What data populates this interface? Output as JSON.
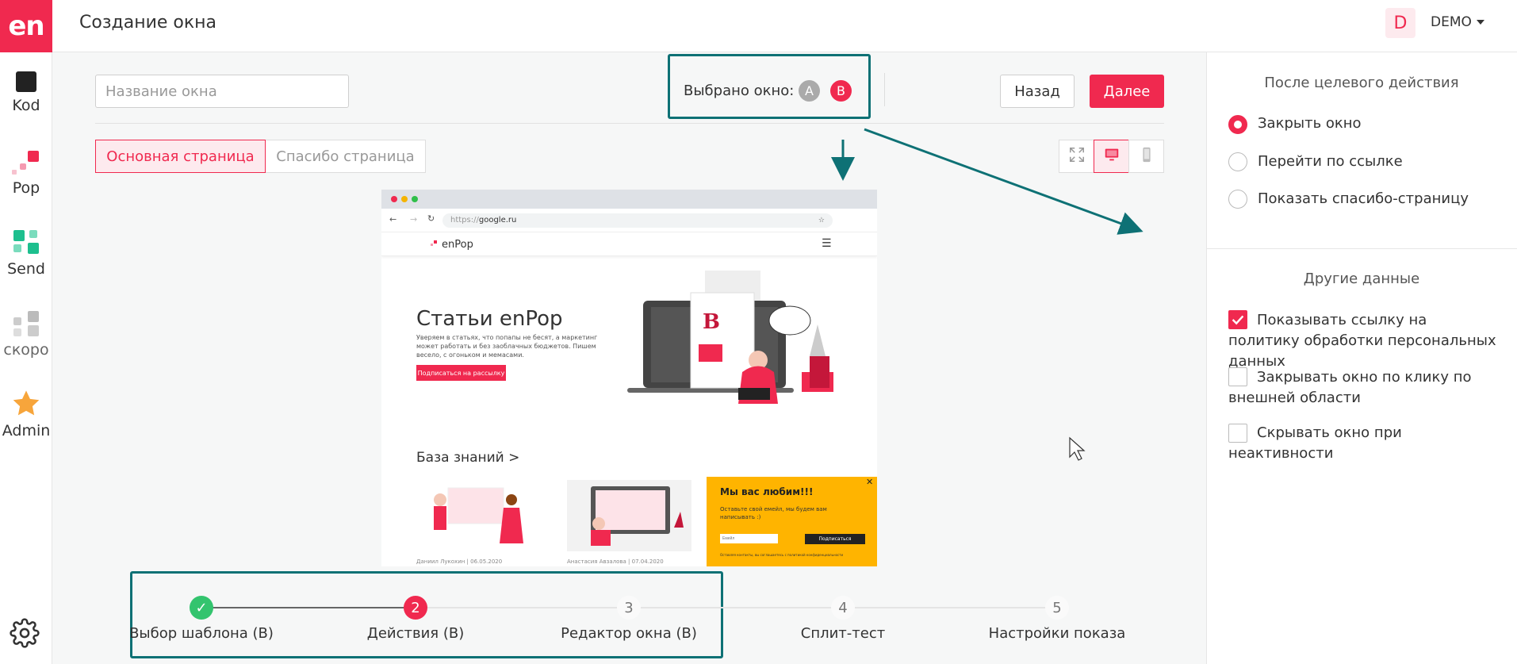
{
  "brand": {
    "logo": "en",
    "accent": "#f0294f",
    "teal": "#0e7175"
  },
  "sidebar": {
    "items": [
      {
        "label": "Kod",
        "icon": "kod-square-icon"
      },
      {
        "label": "Pop",
        "icon": "pop-squares-icon"
      },
      {
        "label": "Send",
        "icon": "send-squares-icon"
      },
      {
        "label": "скоро",
        "icon": "soon-squares-icon"
      },
      {
        "label": "Admin",
        "icon": "star-icon"
      }
    ],
    "settings_icon": "gear-icon"
  },
  "header": {
    "title": "Создание окна",
    "avatar": "D",
    "user": "DEMO"
  },
  "toolbar": {
    "name_placeholder": "Название окна",
    "selected_label": "Выбрано окно:",
    "variant_a": "A",
    "variant_b": "B",
    "back": "Назад",
    "next": "Далее"
  },
  "tabs": [
    {
      "label": "Основная страница",
      "active": true
    },
    {
      "label": "Спасибо страница",
      "active": false
    }
  ],
  "view_modes": [
    "expand-icon",
    "desktop-icon",
    "mobile-icon"
  ],
  "preview": {
    "url_prefix": "https://",
    "url": "google.ru",
    "site_logo": "enPop",
    "hero_title": "Статьи enPop",
    "hero_text": "Уверяем в статьях, что попапы не бесят, а маркетинг может работать и без заоблачных бюджетов. Пишем весело, с огоньком и мемасами.",
    "hero_button": "Подписаться на рассылку",
    "kb_title": "База знаний >",
    "card1_meta": "Даниил Лукохин | 06.05.2020",
    "card2_meta": "Анастасия Авзалова | 07.04.2020",
    "popup": {
      "title": "Мы вас любим!!!",
      "text": "Оставьте свой емейл, мы будем вам напиcывать :)",
      "input_placeholder": "Емейл",
      "button": "Подписаться",
      "note": "Оставляя контакты, вы соглашаетесь с политикой конфиденциальности",
      "close": "✕"
    }
  },
  "steps": [
    {
      "number": "✓",
      "label": "Выбор шаблона (B)",
      "state": "done"
    },
    {
      "number": "2",
      "label": "Действия (B)",
      "state": "active"
    },
    {
      "number": "3",
      "label": "Редактор окна (B)",
      "state": "todo"
    },
    {
      "number": "4",
      "label": "Сплит-тест",
      "state": "todo"
    },
    {
      "number": "5",
      "label": "Настройки показа",
      "state": "todo"
    }
  ],
  "right_panel": {
    "after_action_title": "После целевого действия",
    "radios": [
      {
        "label": "Закрыть окно",
        "checked": true
      },
      {
        "label": "Перейти по ссылке",
        "checked": false
      },
      {
        "label": "Показать спасибо-страницу",
        "checked": false
      }
    ],
    "other_title": "Другие данные",
    "checkboxes": [
      {
        "label": "Показывать ссылку на политику обработки персональных данных",
        "checked": true
      },
      {
        "label": "Закрывать окно по клику по внешней области",
        "checked": false
      },
      {
        "label": "Скрывать окно при неактивности",
        "checked": false
      }
    ]
  }
}
